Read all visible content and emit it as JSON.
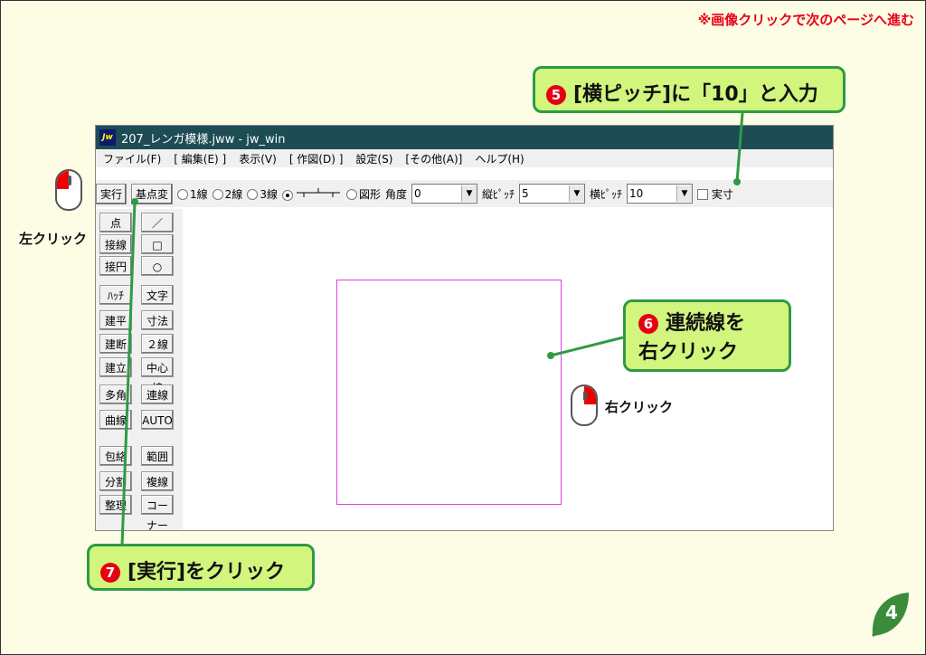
{
  "note": "※画像クリックで次のページへ進む",
  "steps": {
    "s5": {
      "num": "5",
      "text": "[横ピッチ]に「10」と入力"
    },
    "s6": {
      "num": "6",
      "line1": "連続線を",
      "line2": "右クリック"
    },
    "s7": {
      "num": "7",
      "text": "[実行]をクリック"
    }
  },
  "labels": {
    "left_click": "左クリック",
    "right_click": "右クリック"
  },
  "window": {
    "title": "207_レンガ模様.jww - jw_win",
    "logo": "Jw",
    "menu": [
      "ファイル(F)",
      "[ 編集(E) ]",
      "表示(V)",
      "[ 作図(D) ]",
      "設定(S)",
      "[その他(A)]",
      "ヘルプ(H)"
    ],
    "toolbar": {
      "exec": "実行",
      "base": "基点変",
      "r1": "1線",
      "r2": "2線",
      "r3": "3線",
      "r5": "図形",
      "angle_label": "角度",
      "angle_value": "0",
      "vpitch_label": "縦ﾋﾟｯﾁ",
      "vpitch_value": "5",
      "hpitch_label": "横ﾋﾟｯﾁ",
      "hpitch_value": "10",
      "check_label": "実寸"
    },
    "side_left": [
      "点",
      "接線",
      "接円",
      "ﾊｯﾁ",
      "建平",
      "建断",
      "建立",
      "多角形",
      "曲線",
      "包絡",
      "分割",
      "整理"
    ],
    "side_right": [
      "／",
      "□",
      "○",
      "文字",
      "寸法",
      "２線",
      "中心線",
      "連線",
      "AUTO",
      "範囲",
      "複線",
      "コーナー"
    ]
  },
  "page_number": "4",
  "colors": {
    "accent_red": "#e60012",
    "bubble_fill": "#d2f57e",
    "bubble_border": "#2f9a45",
    "rect_magenta": "#e040e0",
    "titlebar": "#1d4c55"
  }
}
